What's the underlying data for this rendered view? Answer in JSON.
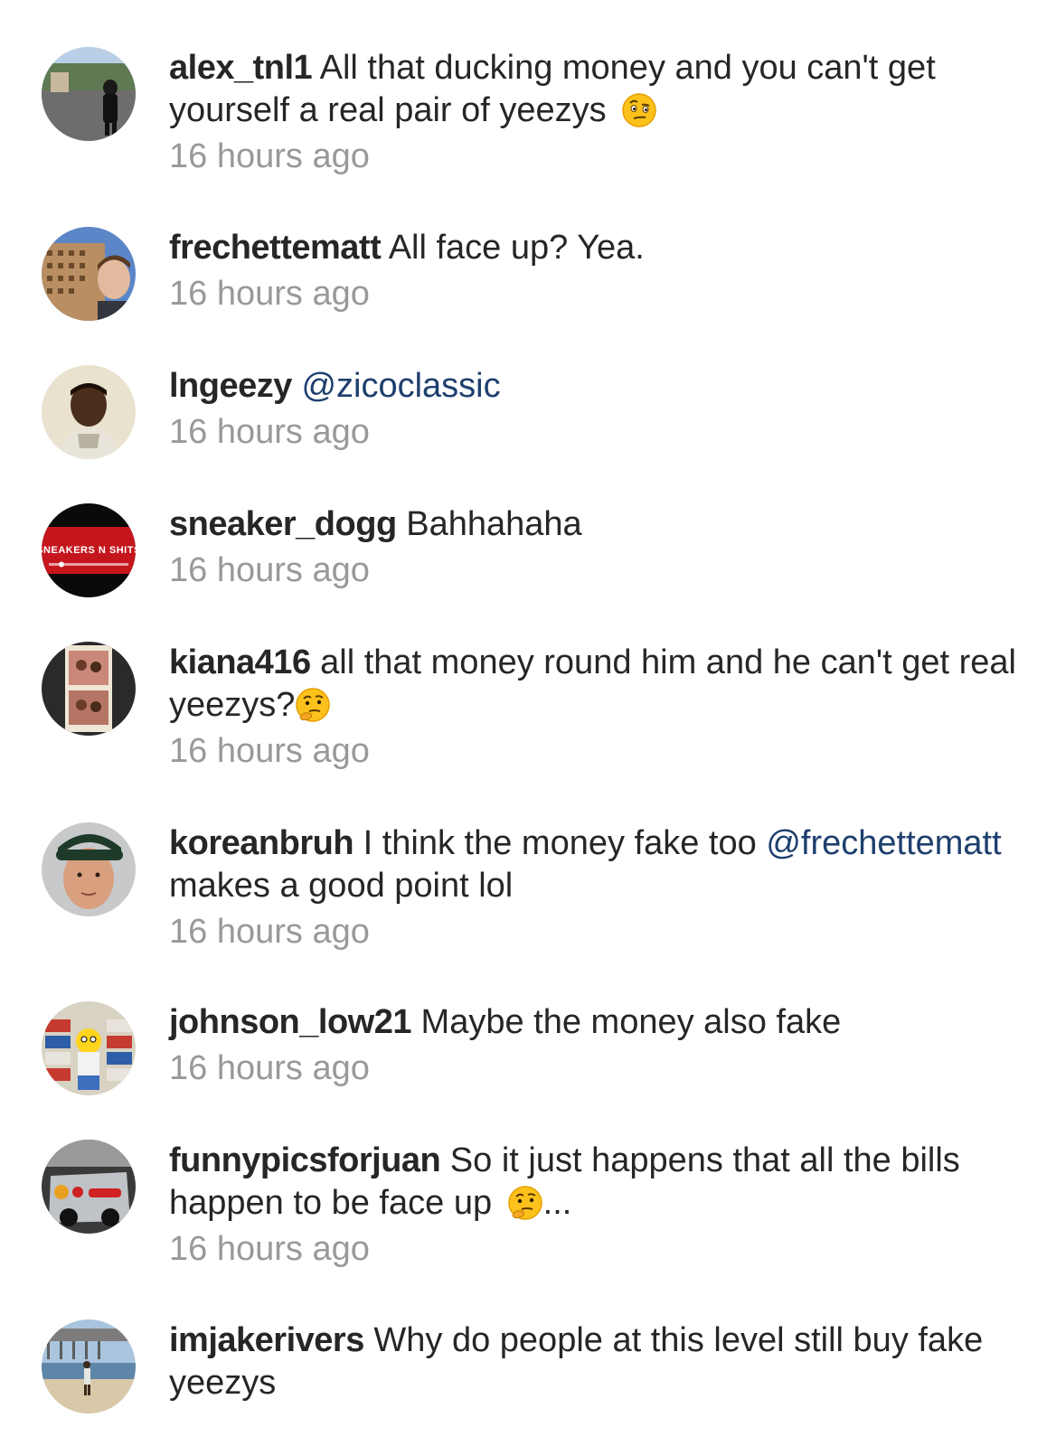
{
  "colors": {
    "background": "#ffffff",
    "text": "#262626",
    "timestamp": "#999999",
    "mention": "#1e3f6e"
  },
  "comments": [
    {
      "username": "alex_tnl1",
      "text_before": "All that ducking money and you can't get yourself a real pair of yeezys",
      "emoji": "raised-eyebrow-emoji",
      "time": "16 hours ago",
      "avatar": "person-in-parking-lot-photo"
    },
    {
      "username": "frechettematt",
      "text_before": "All face up? Yea.",
      "time": "16 hours ago",
      "avatar": "selfie-with-building-photo"
    },
    {
      "username": "lngeezy",
      "mention": "@zicoclassic",
      "time": "16 hours ago",
      "avatar": "man-portrait-photo"
    },
    {
      "username": "sneaker_dogg",
      "text_before": "Bahhahaha",
      "time": "16 hours ago",
      "avatar": "sneakers-n-shits-logo",
      "avatar_text": "SNEAKERS N SHITS"
    },
    {
      "username": "kiana416",
      "text_before": "all that money round him and he can't get real yeezys?",
      "emoji": "thinking-face-emoji",
      "time": "16 hours ago",
      "avatar": "photo-strip-avatar"
    },
    {
      "username": "koreanbruh",
      "text_before": "I think the money fake too",
      "mention": "@frechettematt",
      "text_after": "makes a good point lol",
      "time": "16 hours ago",
      "avatar": "man-with-cap-photo"
    },
    {
      "username": "johnson_low21",
      "text_before": "Maybe the money also fake",
      "time": "16 hours ago",
      "avatar": "cartoon-with-shoe-boxes"
    },
    {
      "username": "funnypicsforjuan",
      "text_before": "So it just happens that all the bills happen to be face up",
      "emoji": "thinking-face-emoji",
      "text_after": "...",
      "time": "16 hours ago",
      "avatar": "car-photo"
    },
    {
      "username": "imjakerivers",
      "text_before": "Why do people at this level still buy fake yeezys",
      "avatar": "beach-photo"
    }
  ]
}
